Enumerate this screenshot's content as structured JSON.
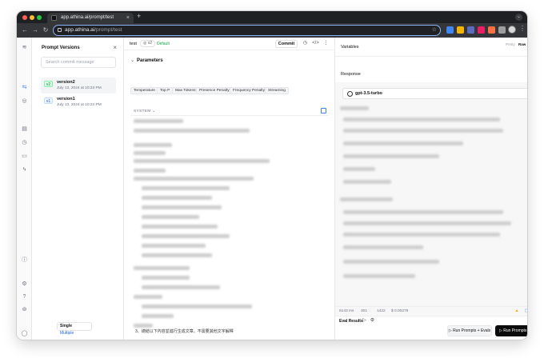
{
  "browser": {
    "tab_title": "app.athina.ai/prompt/test",
    "new_tab": "+",
    "url_host": "app.athina.ai",
    "url_path": "/prompt/test"
  },
  "versions_panel": {
    "title": "Prompt Versions",
    "search_placeholder": "Search commit message",
    "items": [
      {
        "badge": "v2",
        "name": "version2",
        "date": "July 13, 2024 at 10:23 PM"
      },
      {
        "badge": "v1",
        "name": "version1",
        "date": "July 13, 2024 at 10:22 PM"
      }
    ],
    "mode": {
      "single": "Single",
      "multiple": "Multiple"
    }
  },
  "editor": {
    "prompt_name": "test",
    "version_pill": "v2",
    "default_tag": "Default",
    "commit_label": "Commit",
    "params_title": "Parameters",
    "params": [
      "Temperature",
      "Top P",
      "Max Tokens",
      "Presence Penalty",
      "Frequency Penalty",
      "Streaming"
    ],
    "system_label": "SYSTEM",
    "footer_text": "3、總結以下內容並進行生成文章。不需要其他文字解釋"
  },
  "right_panel": {
    "variables_label": "Variables",
    "response_label": "Response",
    "view_pretty": "Pretty",
    "view_raw": "Raw",
    "model": "gpt-3.5-turbo",
    "stats": {
      "latency": "5143 ms",
      "prompt_tokens": "301",
      "total_tokens": "1422",
      "cost": "$ 0.00279"
    },
    "eval_results_label": "Eval Results",
    "run_with_evals": "Run Prompts + Evals",
    "run_prompts": "Run Prompts",
    "run_shortcut": "⌘↵"
  }
}
